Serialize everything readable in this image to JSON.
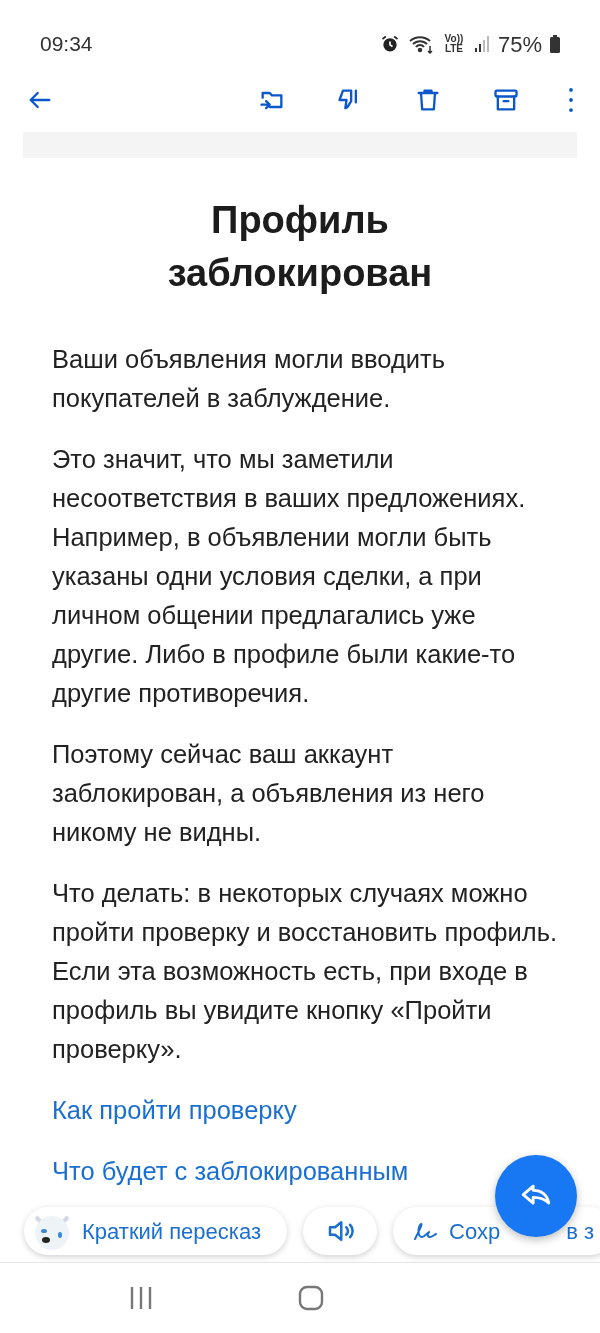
{
  "status_bar": {
    "time": "09:34",
    "network": "Vo)) LTE",
    "battery": "75%"
  },
  "message": {
    "title": "Профиль заблокирован",
    "paragraphs": [
      "Ваши объявления могли вводить покупателей в заблуждение.",
      "Это значит, что мы заметили несоответствия в ваших предложениях. Например, в объявлении могли быть указаны одни условия сделки, а при личном общении предлагались уже другие. Либо в профиле были какие-то другие противоречия.",
      "Поэтому сейчас ваш аккаунт заблокирован, а объявления из него никому не видны.",
      "Что делать: в некоторых случаях можно пройти проверку и восстановить профиль. Если эта возможность есть, при входе в профиль вы увидите кнопку «Пройти проверку»."
    ],
    "links": [
      "Как пройти проверку",
      "Что будет с заблокированным"
    ]
  },
  "chips": [
    {
      "kind": "summary",
      "label": "Краткий пересказ"
    },
    {
      "kind": "speak"
    },
    {
      "kind": "save",
      "label": "Сохр",
      "label_tail": "в з"
    }
  ]
}
